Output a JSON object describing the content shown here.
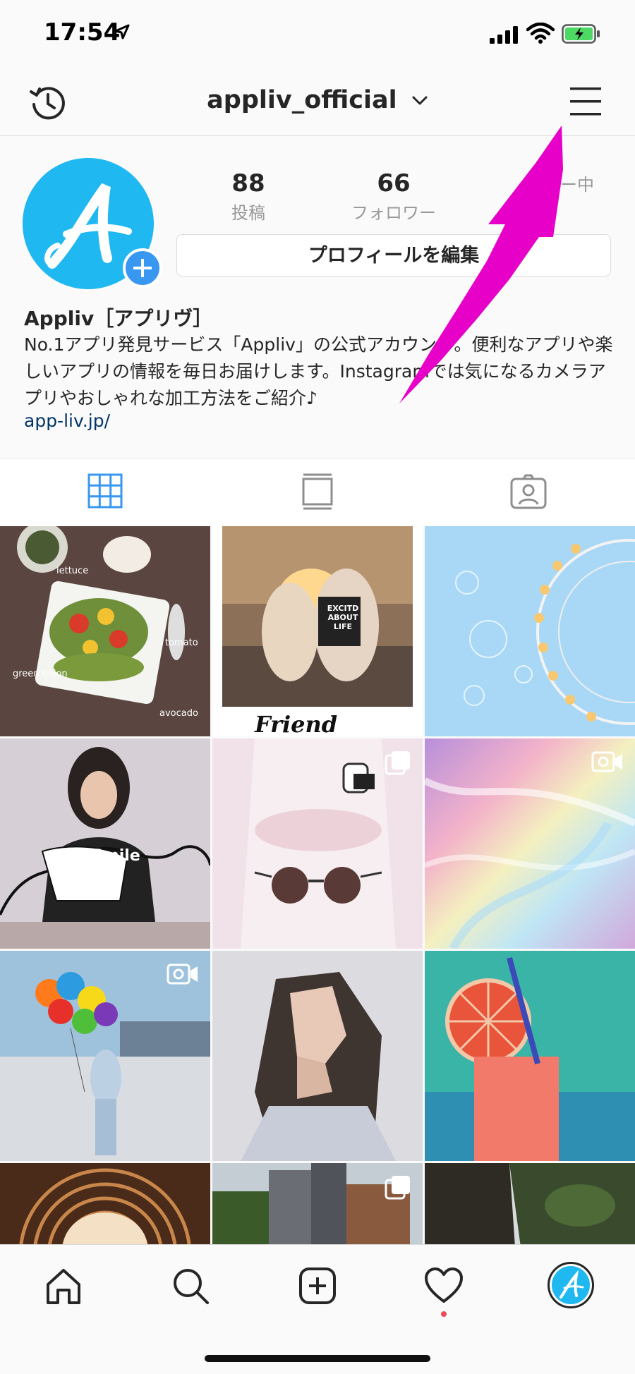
{
  "status": {
    "time": "17:54"
  },
  "header": {
    "username": "appliv_official"
  },
  "profile": {
    "avatar_letter": "A",
    "stats": [
      {
        "value": "88",
        "label": "投稿"
      },
      {
        "value": "66",
        "label": "フォロワー"
      },
      {
        "value": "",
        "label": "ー中"
      }
    ],
    "edit_button": "プロフィールを編集",
    "name": "Appliv［アプリヴ］",
    "bio": "No.1アプリ発見サービス「Appliv」の公式アカウント。便利なアプリや楽しいアプリの情報を毎日お届けします。Instagramでは気になるカメラアプリやおしゃれな加工方法をご紹介♪",
    "link": "app-liv.jp/"
  },
  "tabs": [
    {
      "icon": "grid-icon",
      "active": true
    },
    {
      "icon": "feed-icon",
      "active": false
    },
    {
      "icon": "tagged-icon",
      "active": false
    }
  ],
  "grid_posts": [
    {
      "name": "post-salad",
      "labels": [
        "lettuce",
        "tomato",
        "green onion",
        "avocado"
      ],
      "overlay": ""
    },
    {
      "name": "post-friends",
      "labels": [
        "EXCITD ABOUT LIFE",
        "Friend"
      ],
      "overlay": ""
    },
    {
      "name": "post-ferris-wheel",
      "labels": [],
      "overlay": ""
    },
    {
      "name": "post-smile-girl",
      "labels": [
        "Smile"
      ],
      "overlay": ""
    },
    {
      "name": "post-sunglasses",
      "labels": [],
      "overlay": "multi-icon"
    },
    {
      "name": "post-hologram",
      "labels": [],
      "overlay": "video-icon"
    },
    {
      "name": "post-balloons",
      "labels": [],
      "overlay": "video-icon"
    },
    {
      "name": "post-lowpoly-girl",
      "labels": [],
      "overlay": ""
    },
    {
      "name": "post-orange-drink",
      "labels": [],
      "overlay": ""
    },
    {
      "name": "post-coffee-maze",
      "labels": [],
      "overlay": ""
    },
    {
      "name": "post-buildings",
      "labels": [],
      "overlay": "multi-icon"
    },
    {
      "name": "post-cliffs",
      "labels": [],
      "overlay": ""
    }
  ],
  "nav": {
    "items": [
      "home-icon",
      "search-icon",
      "add-post-icon",
      "activity-icon",
      "profile-avatar"
    ],
    "has_activity_dot": true
  },
  "colors": {
    "accent_blue": "#3897f0",
    "avatar_blue": "#1fb8f0",
    "arrow_magenta": "#e600c8",
    "link": "#003569",
    "notification_dot": "#ed4956"
  }
}
